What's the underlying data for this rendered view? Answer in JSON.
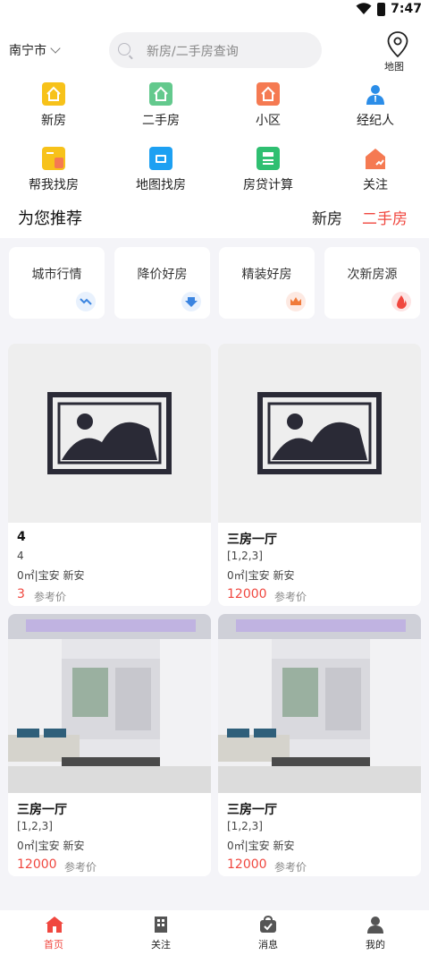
{
  "status": {
    "time": "7:47"
  },
  "header": {
    "city": "南宁市",
    "search_placeholder": "新房/二手房查询",
    "map_label": "地图"
  },
  "categories": [
    {
      "label": "新房",
      "icon": "new-house-icon"
    },
    {
      "label": "二手房",
      "icon": "second-hand-house-icon"
    },
    {
      "label": "小区",
      "icon": "community-icon"
    },
    {
      "label": "经纪人",
      "icon": "agent-icon"
    },
    {
      "label": "帮我找房",
      "icon": "find-house-icon"
    },
    {
      "label": "地图找房",
      "icon": "map-search-icon"
    },
    {
      "label": "房贷计算",
      "icon": "mortgage-calculator-icon"
    },
    {
      "label": "关注",
      "icon": "follow-icon"
    }
  ],
  "recommend": {
    "title": "为您推荐",
    "tabs": [
      "新房",
      "二手房"
    ],
    "active_tab": "二手房"
  },
  "filters": [
    {
      "label": "城市行情",
      "icon": "trend-icon"
    },
    {
      "label": "降价好房",
      "icon": "price-drop-icon"
    },
    {
      "label": "精装好房",
      "icon": "crown-icon"
    },
    {
      "label": "次新房源",
      "icon": "fire-icon"
    }
  ],
  "listings": [
    {
      "title": "4",
      "sub": "4",
      "loc": "0㎡|宝安 新安",
      "price": "3",
      "ref": "参考价",
      "image": "placeholder"
    },
    {
      "title": "三房一厅",
      "sub": "[1,2,3]",
      "loc": "0㎡|宝安 新安",
      "price": "12000",
      "ref": "参考价",
      "image": "placeholder"
    },
    {
      "title": "三房一厅",
      "sub": "[1,2,3]",
      "loc": "0㎡|宝安 新安",
      "price": "12000",
      "ref": "参考价",
      "image": "interior"
    },
    {
      "title": "三房一厅",
      "sub": "[1,2,3]",
      "loc": "0㎡|宝安 新安",
      "price": "12000",
      "ref": "参考价",
      "image": "interior"
    }
  ],
  "nav": [
    {
      "label": "首页",
      "icon": "home-icon",
      "active": true
    },
    {
      "label": "关注",
      "icon": "building-icon",
      "active": false
    },
    {
      "label": "消息",
      "icon": "message-bag-icon",
      "active": false
    },
    {
      "label": "我的",
      "icon": "profile-icon",
      "active": false
    }
  ],
  "colors": {
    "accent": "#f0473f",
    "background": "#f4f4f8"
  }
}
